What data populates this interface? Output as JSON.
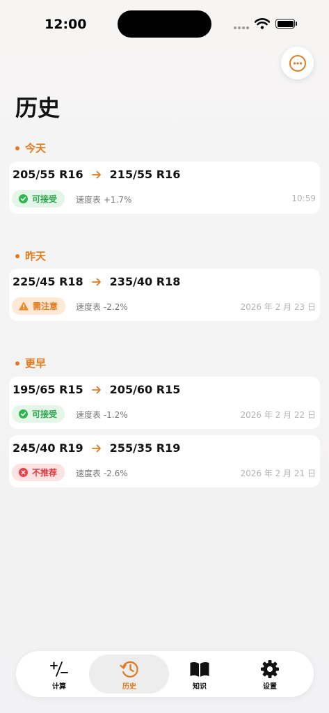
{
  "status_bar": {
    "time": "12:00"
  },
  "page": {
    "title": "历史"
  },
  "accent_color": "#e07b1f",
  "sections": [
    {
      "label": "今天",
      "items": [
        {
          "from": "205/55 R16",
          "to": "215/55 R16",
          "badge": "可接受",
          "status": "acceptable",
          "speedo": "速度表 +1.7%",
          "time": "10:59"
        }
      ]
    },
    {
      "label": "昨天",
      "items": [
        {
          "from": "225/45 R18",
          "to": "235/40 R18",
          "badge": "需注意",
          "status": "caution",
          "speedo": "速度表 -2.2%",
          "time": "2026 年 2 月 23 日"
        }
      ]
    },
    {
      "label": "更早",
      "items": [
        {
          "from": "195/65 R15",
          "to": "205/60 R15",
          "badge": "可接受",
          "status": "acceptable",
          "speedo": "速度表 -1.2%",
          "time": "2026 年 2 月 22 日"
        },
        {
          "from": "245/40 R19",
          "to": "255/35 R19",
          "badge": "不推荐",
          "status": "not-recommended",
          "speedo": "速度表 -2.6%",
          "time": "2026 年 2 月 21 日"
        }
      ]
    }
  ],
  "tabs": [
    {
      "label": "计算",
      "icon": "plus-minus-icon",
      "active": false
    },
    {
      "label": "历史",
      "icon": "history-icon",
      "active": true
    },
    {
      "label": "知识",
      "icon": "book-icon",
      "active": false
    },
    {
      "label": "设置",
      "icon": "gear-icon",
      "active": false
    }
  ]
}
